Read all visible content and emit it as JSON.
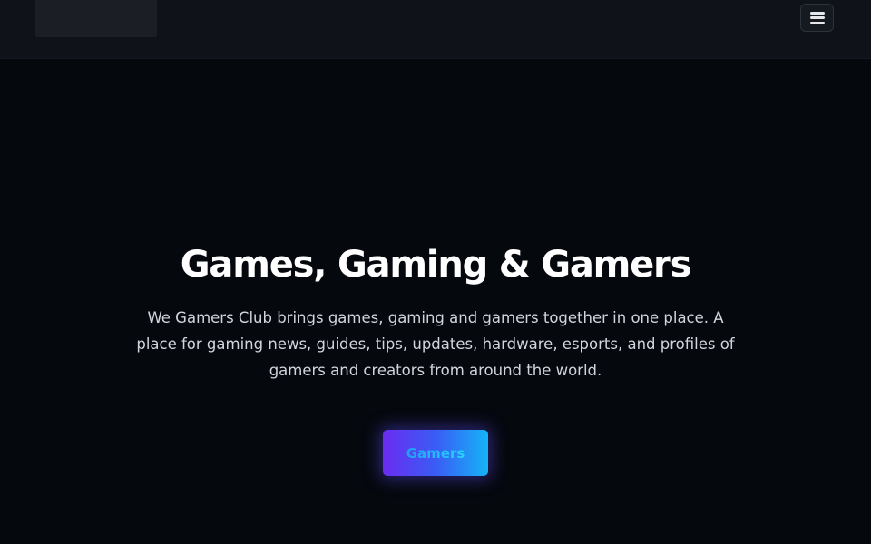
{
  "navbar": {
    "logo_icon": "site-logo",
    "menu_icon": "hamburger-icon"
  },
  "hero": {
    "title": "Games, Gaming & Gamers",
    "description": "We Gamers Club brings games, gaming and gamers together in one place. A place for gaming news, guides, tips, updates, hardware, esports, and profiles of gamers and creators from around the world.",
    "cta_label": "Gamers"
  },
  "colors": {
    "background": "#05080d",
    "navbar": "#0f1219",
    "cta_gradient_start": "#6a2cf0",
    "cta_gradient_end": "#14b4f6",
    "cta_text": "#1fa0f5"
  }
}
